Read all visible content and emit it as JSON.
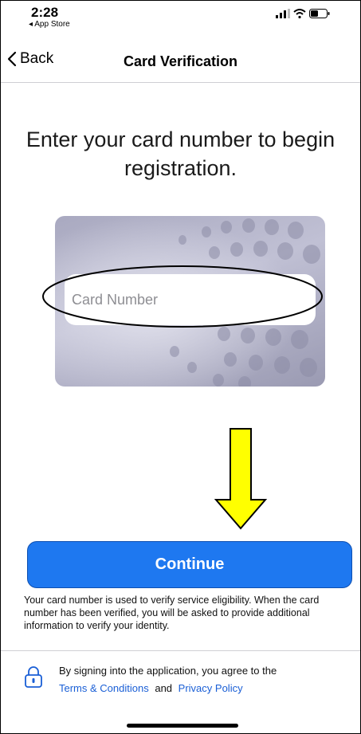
{
  "status_bar": {
    "time": "2:28",
    "back_app": "◂ App Store",
    "icons": [
      "signal-icon",
      "wifi-icon",
      "battery-icon"
    ]
  },
  "nav": {
    "back_label": "Back",
    "title": "Card Verification"
  },
  "main": {
    "heading": "Enter your card number to begin registration.",
    "card_number_placeholder": "Card Number",
    "card_number_value": "",
    "continue_label": "Continue",
    "info": "Your card number is used to verify service eligibility. When the card number has been verified, you will be asked to provide additional information to verify your identity."
  },
  "footer": {
    "agreement_text": "By signing into the application, you agree to the",
    "terms_label": "Terms & Conditions",
    "and_text": "and",
    "privacy_label": "Privacy Policy"
  },
  "colors": {
    "accent": "#1e78f0",
    "link": "#1a5fd6",
    "annotation_arrow": "#ffff00"
  }
}
